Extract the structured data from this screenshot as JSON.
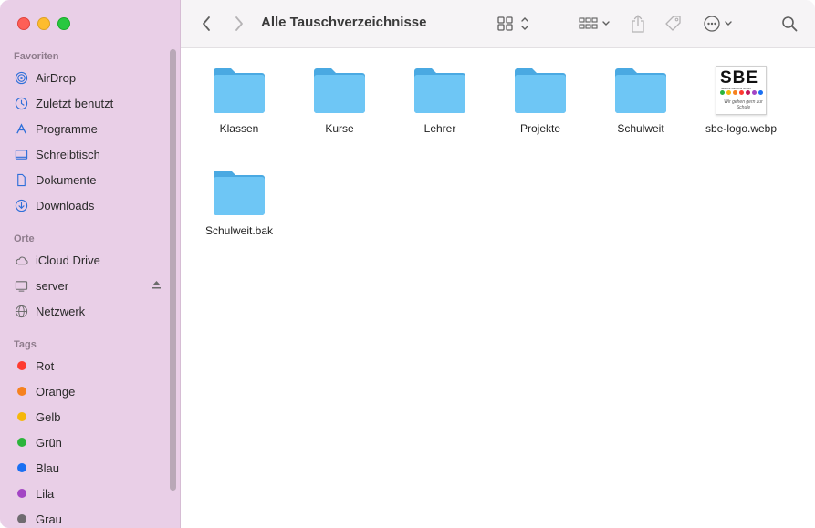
{
  "window": {
    "title": "Alle Tauschverzeichnisse"
  },
  "sidebar": {
    "favorites_title": "Favoriten",
    "favorites": [
      {
        "label": "AirDrop",
        "icon": "airdrop-icon"
      },
      {
        "label": "Zuletzt benutzt",
        "icon": "clock-icon"
      },
      {
        "label": "Programme",
        "icon": "applications-icon"
      },
      {
        "label": "Schreibtisch",
        "icon": "desktop-icon"
      },
      {
        "label": "Dokumente",
        "icon": "document-icon"
      },
      {
        "label": "Downloads",
        "icon": "download-icon"
      }
    ],
    "locations_title": "Orte",
    "locations": [
      {
        "label": "iCloud Drive",
        "icon": "cloud-icon"
      },
      {
        "label": "server",
        "icon": "computer-icon"
      },
      {
        "label": "Netzwerk",
        "icon": "network-icon"
      }
    ],
    "tags_title": "Tags",
    "tags": [
      {
        "label": "Rot",
        "color": "#fe3b30"
      },
      {
        "label": "Orange",
        "color": "#f6821f"
      },
      {
        "label": "Gelb",
        "color": "#f5b70a"
      },
      {
        "label": "Grün",
        "color": "#2bb43b"
      },
      {
        "label": "Blau",
        "color": "#1a6ff2"
      },
      {
        "label": "Lila",
        "color": "#a345c4"
      },
      {
        "label": "Grau",
        "color": "#6f6b70"
      }
    ]
  },
  "files": [
    {
      "name": "Klassen",
      "type": "folder"
    },
    {
      "name": "Kurse",
      "type": "folder"
    },
    {
      "name": "Lehrer",
      "type": "folder"
    },
    {
      "name": "Projekte",
      "type": "folder"
    },
    {
      "name": "Schulweit",
      "type": "folder"
    },
    {
      "name": "sbe-logo.webp",
      "type": "image"
    },
    {
      "name": "Schulweit.bak",
      "type": "folder"
    }
  ],
  "logo": {
    "brand": "SBE",
    "sub": "network solutions GmbH",
    "tagline": "Wir gehen gern zur Schule"
  },
  "colors": {
    "sidebar_bg": "#e9cfe7",
    "folder": "#6ec6f5",
    "folder_dark": "#4aa9e2"
  }
}
